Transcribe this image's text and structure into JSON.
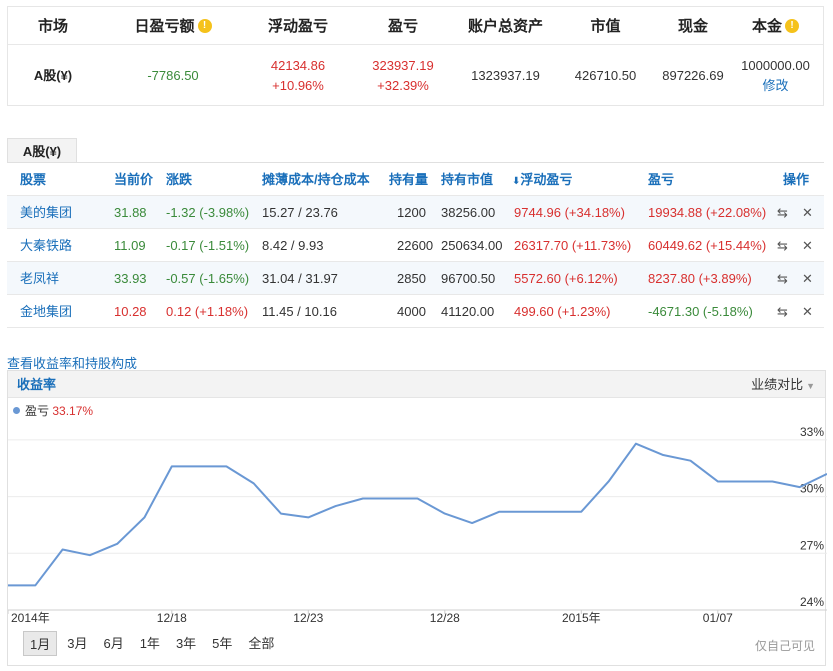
{
  "summary": {
    "headers": {
      "market": "市场",
      "daily_pl": "日盈亏额",
      "floating_pl": "浮动盈亏",
      "pl": "盈亏",
      "total_assets": "账户总资产",
      "market_value": "市值",
      "cash": "现金",
      "principal": "本金"
    },
    "info_glyph": "!",
    "row": {
      "market": "A股(¥)",
      "daily_pl": "-7786.50",
      "floating_pl_value": "42134.86",
      "floating_pl_pct": "+10.96%",
      "pl_value": "323937.19",
      "pl_pct": "+32.39%",
      "total_assets": "1323937.19",
      "market_value": "426710.50",
      "cash": "897226.69",
      "principal": "1000000.00",
      "edit_label": "修改"
    }
  },
  "holdings": {
    "tab_label": "A股(¥)",
    "columns": {
      "stock": "股票",
      "price": "当前价",
      "change": "涨跌",
      "cost": "摊薄成本/持仓成本",
      "qty": "持有量",
      "value": "持有市值",
      "floating": "浮动盈亏",
      "pl": "盈亏",
      "ops": "操作"
    },
    "sort_glyph": "⬇",
    "rows": [
      {
        "name": "美的集团",
        "price": "31.88",
        "change": "-1.32 (-3.98%)",
        "cost": "15.27 / 23.76",
        "qty": "1200",
        "value": "38256.00",
        "floating": "9744.96 (+34.18%)",
        "pl": "19934.88 (+22.08%)",
        "change_color": "green",
        "price_color": "green",
        "floating_color": "red",
        "pl_color": "red"
      },
      {
        "name": "大秦铁路",
        "price": "11.09",
        "change": "-0.17 (-1.51%)",
        "cost": "8.42 / 9.93",
        "qty": "22600",
        "value": "250634.00",
        "floating": "26317.70 (+11.73%)",
        "pl": "60449.62 (+15.44%)",
        "change_color": "green",
        "price_color": "green",
        "floating_color": "red",
        "pl_color": "red"
      },
      {
        "name": "老凤祥",
        "price": "33.93",
        "change": "-0.57 (-1.65%)",
        "cost": "31.04 / 31.97",
        "qty": "2850",
        "value": "96700.50",
        "floating": "5572.60 (+6.12%)",
        "pl": "8237.80 (+3.89%)",
        "change_color": "green",
        "price_color": "green",
        "floating_color": "red",
        "pl_color": "red"
      },
      {
        "name": "金地集团",
        "price": "10.28",
        "change": "0.12 (+1.18%)",
        "cost": "11.45 / 10.16",
        "qty": "4000",
        "value": "41120.00",
        "floating": "499.60 (+1.23%)",
        "pl": "-4671.30 (-5.18%)",
        "change_color": "red",
        "price_color": "red",
        "floating_color": "red",
        "pl_color": "green"
      }
    ],
    "op_icons": {
      "transfer": "⇆",
      "delete": "✕"
    }
  },
  "chart_section": {
    "view_link": "查看收益率和持股构成",
    "title": "收益率",
    "compare_label": "业绩对比",
    "legend_name": "盈亏",
    "legend_value": "33.17%",
    "ranges": [
      "1月",
      "3月",
      "6月",
      "1年",
      "3年",
      "5年",
      "全部"
    ],
    "active_range": "1月",
    "footnote": "仅自己可见"
  },
  "chart_data": {
    "type": "line",
    "series": [
      {
        "name": "盈亏",
        "values": [
          25.3,
          25.3,
          27.2,
          26.9,
          27.5,
          28.9,
          31.6,
          31.6,
          31.6,
          30.7,
          29.1,
          28.9,
          29.5,
          29.9,
          29.9,
          29.9,
          29.1,
          28.6,
          29.2,
          29.2,
          29.2,
          29.2,
          30.8,
          32.8,
          32.2,
          31.9,
          30.8,
          30.8,
          30.8,
          30.5,
          31.2
        ]
      }
    ],
    "x_tick_labels": [
      "2014年",
      "12/18",
      "12/23",
      "12/28",
      "2015年",
      "01/07"
    ],
    "x_tick_index": [
      0,
      6,
      11,
      16,
      21,
      26
    ],
    "y_ticks": [
      24,
      27,
      30,
      33
    ],
    "y_tick_labels": [
      "24%",
      "27%",
      "30%",
      "33%"
    ],
    "ylim": [
      24,
      34
    ],
    "line_color": "#6a98d4",
    "grid": true
  }
}
